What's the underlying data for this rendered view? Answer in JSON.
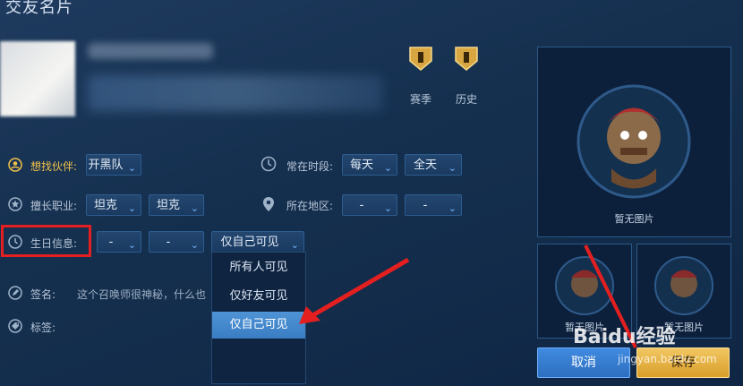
{
  "window": {
    "title": "交友名片"
  },
  "badges": [
    {
      "label": "赛季",
      "icon": "season-badge-icon"
    },
    {
      "label": "历史",
      "icon": "history-badge-icon"
    }
  ],
  "form": {
    "partner": {
      "label": "想找伙伴:",
      "value": "开黑队"
    },
    "time": {
      "label": "常在时段:",
      "day": "每天",
      "period": "全天"
    },
    "role": {
      "label": "擅长职业:",
      "value1": "坦克",
      "value2": "坦克"
    },
    "region": {
      "label": "所在地区:",
      "value1": "-",
      "value2": "-"
    },
    "birthday": {
      "label": "生日信息:",
      "month": "-",
      "day": "-",
      "visibility": "仅自己可见"
    },
    "signature": {
      "label": "签名:",
      "text": "这个召唤师很神秘，什么也"
    },
    "tags": {
      "label": "标签:"
    }
  },
  "visibility_dropdown": {
    "options": [
      "所有人可见",
      "仅好友可见",
      "仅自己可见"
    ],
    "selected": "仅自己可见"
  },
  "photos": {
    "main_caption": "暂无图片",
    "thumb1_caption": "暂无图片",
    "thumb2_caption": "暂无图片"
  },
  "buttons": {
    "cancel": "取消",
    "save": "保存"
  },
  "watermark": {
    "brand": "Baidu经验",
    "url": "jingyan.baidu.com"
  },
  "colors": {
    "highlight": "#f1c24a",
    "annotation_red": "#e41f1f",
    "select_blue": "#2d5d90"
  }
}
